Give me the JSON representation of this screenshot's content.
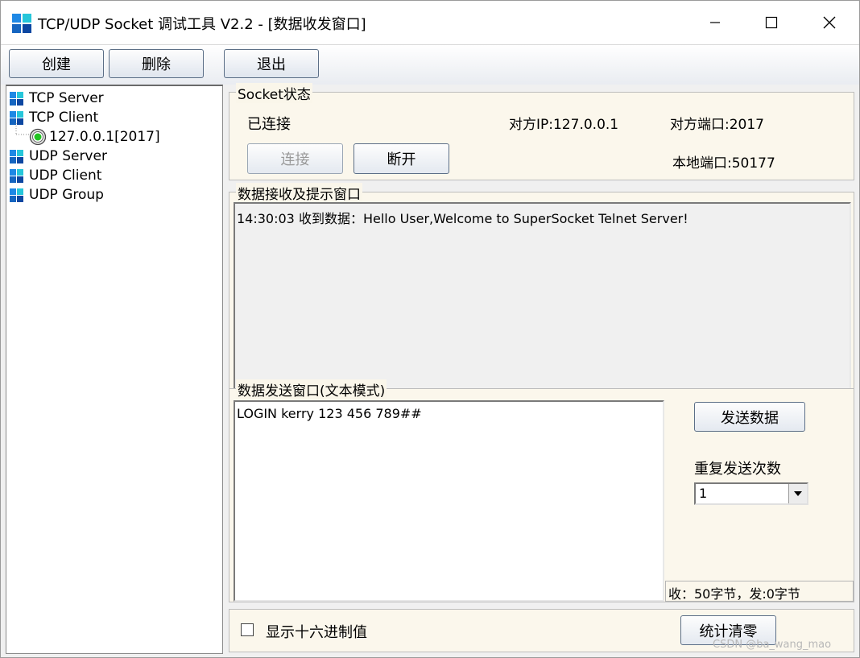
{
  "window": {
    "title": "TCP/UDP Socket 调试工具 V2.2 - [数据收发窗口]"
  },
  "toolbar": {
    "create_label": "创建",
    "delete_label": "删除",
    "exit_label": "退出"
  },
  "tree": {
    "items": [
      {
        "label": "TCP Server"
      },
      {
        "label": "TCP Client"
      },
      {
        "label": "127.0.0.1[2017]"
      },
      {
        "label": "UDP Server"
      },
      {
        "label": "UDP Client"
      },
      {
        "label": "UDP Group"
      }
    ]
  },
  "socket_status": {
    "title": "Socket状态",
    "state": "已连接",
    "remote_ip": "对方IP:127.0.0.1",
    "remote_port": "对方端口:2017",
    "local_port": "本地端口:50177",
    "connect_label": "连接",
    "disconnect_label": "断开"
  },
  "receive": {
    "title": "数据接收及提示窗口",
    "log": "14:30:03 收到数据：Hello User,Welcome to SuperSocket Telnet Server!"
  },
  "send": {
    "title": "数据发送窗口(文本模式)",
    "text": "LOGIN kerry 123 456 789##",
    "send_label": "发送数据",
    "repeat_label": "重复发送次数",
    "repeat_value": "1",
    "stats": "收：50字节，发:0字节"
  },
  "footer": {
    "hex_label": "显示十六进制值",
    "clear_stats_label": "统计清零",
    "watermark": "CSDN @ba_wang_mao"
  },
  "colors": {
    "accent_blue": "#1565c0",
    "accent_cyan": "#26c6da",
    "panel_cream": "#fbf7ec",
    "status_green": "#22c422"
  }
}
